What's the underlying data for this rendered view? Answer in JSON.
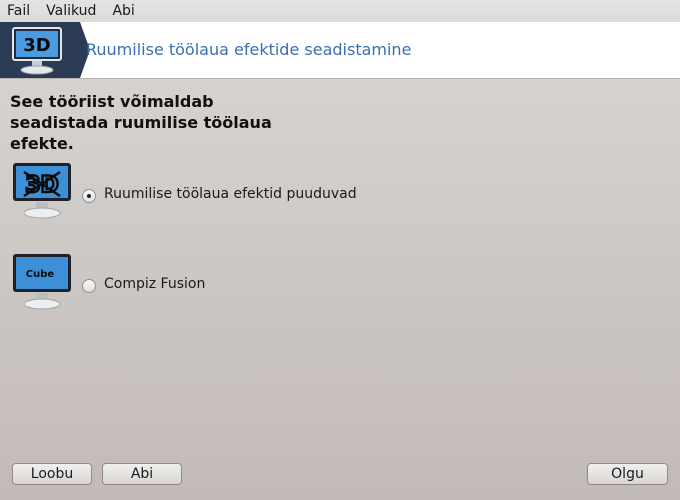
{
  "menubar": {
    "items": [
      "Fail",
      "Valikud",
      "Abi"
    ]
  },
  "banner": {
    "icon": "3d-monitor-icon",
    "icon_text": "3D",
    "title": "Ruumilise töölaua efektide seadistamine"
  },
  "intro": "See tööriist võimaldab seadistada ruumilise töölaua efekte.",
  "options": [
    {
      "label": "Ruumilise töölaua efektid puuduvad",
      "selected": true,
      "icon": "no-3d-monitor-icon",
      "icon_text": "3D"
    },
    {
      "label": "Compiz Fusion",
      "selected": false,
      "icon": "cube-monitor-icon",
      "icon_text": "Cube"
    }
  ],
  "buttons": {
    "cancel": "Loobu",
    "help": "Abi",
    "ok": "Olgu"
  },
  "colors": {
    "banner_bg": "#2b3a55",
    "title": "#3a6fb0",
    "screen": "#3d8fd8"
  }
}
